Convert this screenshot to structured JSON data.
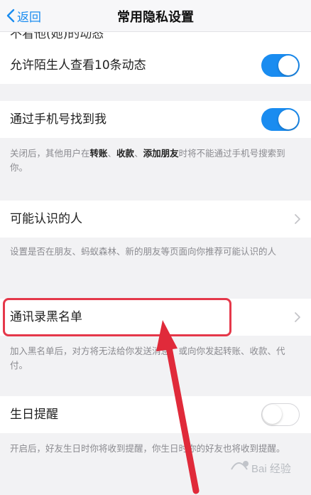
{
  "nav": {
    "back_label": "返回",
    "title": "常用隐私设置"
  },
  "rows": {
    "cut_text": "不看他(她)的动态",
    "stranger": {
      "label": "允许陌生人查看10条动态",
      "enabled": true
    },
    "phone": {
      "label": "通过手机号找到我",
      "enabled": true,
      "note_parts": [
        "关闭后，其他用户在",
        "转账",
        "、",
        "收款",
        "、",
        "添加朋友",
        "时将不能通过手机号搜索到你。"
      ]
    },
    "maybe_know": {
      "label": "可能认识的人",
      "note": "设置是否在朋友、蚂蚁森林、新的朋友等页面向你推荐可能认识的人"
    },
    "blacklist": {
      "label": "通讯录黑名单",
      "note": "加入黑名单后，对方将无法给你发送消息，或向你发起转账、收款、代付。"
    },
    "birthday": {
      "label": "生日提醒",
      "enabled": false,
      "note": "开启后，好友生日时你将收到提醒，你生日时你的好友也将收到提醒。"
    }
  },
  "watermark": {
    "text": "Bai 经验"
  },
  "colors": {
    "accent": "#1a8cf0",
    "highlight": "#e5384a",
    "arrow": "#e02a3a"
  },
  "icons": {
    "back": "chevron-left-icon",
    "row_arrow": "chevron-right-icon"
  }
}
